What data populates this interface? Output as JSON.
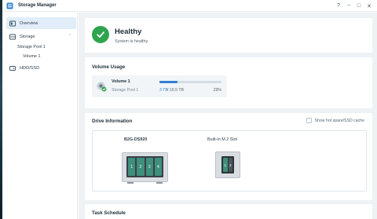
{
  "window": {
    "title": "Storage Manager",
    "controls": [
      "?",
      "−",
      "□",
      "✕"
    ]
  },
  "sidebar": {
    "items": [
      {
        "label": "Overview",
        "icon": "overview-icon",
        "active": true
      },
      {
        "label": "Storage",
        "icon": "storage-icon",
        "expanded": true
      },
      {
        "label": "HDD/SSD",
        "icon": "hdd-icon"
      }
    ],
    "sub": {
      "pool": "Storage Pool 1",
      "volume": "Volume 1"
    }
  },
  "health": {
    "title": "Healthy",
    "subtitle": "System is healthy.",
    "color": "#2ea44f"
  },
  "volume_usage": {
    "heading": "Volume Usage",
    "volume_name": "Volume 1",
    "pool_name": "Storage Pool 1",
    "used": "3 TB",
    "total": "/ 10.5 TB",
    "percent_text": "29%",
    "percent": 29,
    "bar_color": "#2f7fd1"
  },
  "drive_info": {
    "heading": "Drive Information",
    "hotspare_label": "Show hot spare/SSD cache",
    "nas_model": "B2G-DS920",
    "nas_bays": [
      "1",
      "2",
      "3",
      "4"
    ],
    "m2_label": "Built-In M.2 Slot",
    "m2_slots": [
      "1",
      "2"
    ]
  },
  "task": {
    "heading": "Task Schedule"
  }
}
